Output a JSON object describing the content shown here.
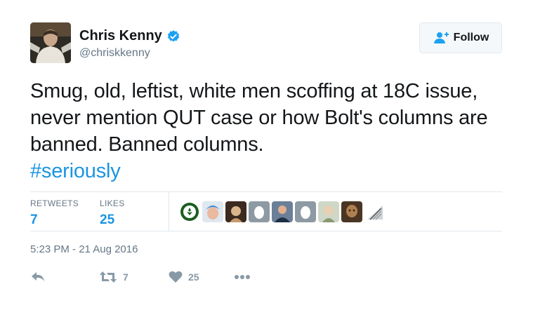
{
  "author": {
    "name": "Chris Kenny",
    "handle": "@chriskkenny",
    "verified": true
  },
  "follow_button": {
    "label": "Follow",
    "icon": "add-user-icon"
  },
  "tweet": {
    "text": "Smug, old, leftist, white men scoffing at 18C issue, never mention QUT case or how Bolt's columns are banned. Banned columns.",
    "hashtag": "#seriously"
  },
  "stats": {
    "retweets_label": "RETWEETS",
    "retweets": "7",
    "likes_label": "LIKES",
    "likes": "25"
  },
  "likers_count_shown": 9,
  "timestamp": "5:23 PM - 21 Aug 2016",
  "actions": {
    "reply_icon": "reply-icon",
    "retweet_icon": "retweet-icon",
    "retweet_count": "7",
    "like_icon": "heart-icon",
    "like_count": "25",
    "more_icon": "more-icon"
  },
  "colors": {
    "accent": "#1b95e0",
    "muted": "#657786",
    "action_gray": "#8899a6",
    "divider": "#e1e8ed"
  }
}
